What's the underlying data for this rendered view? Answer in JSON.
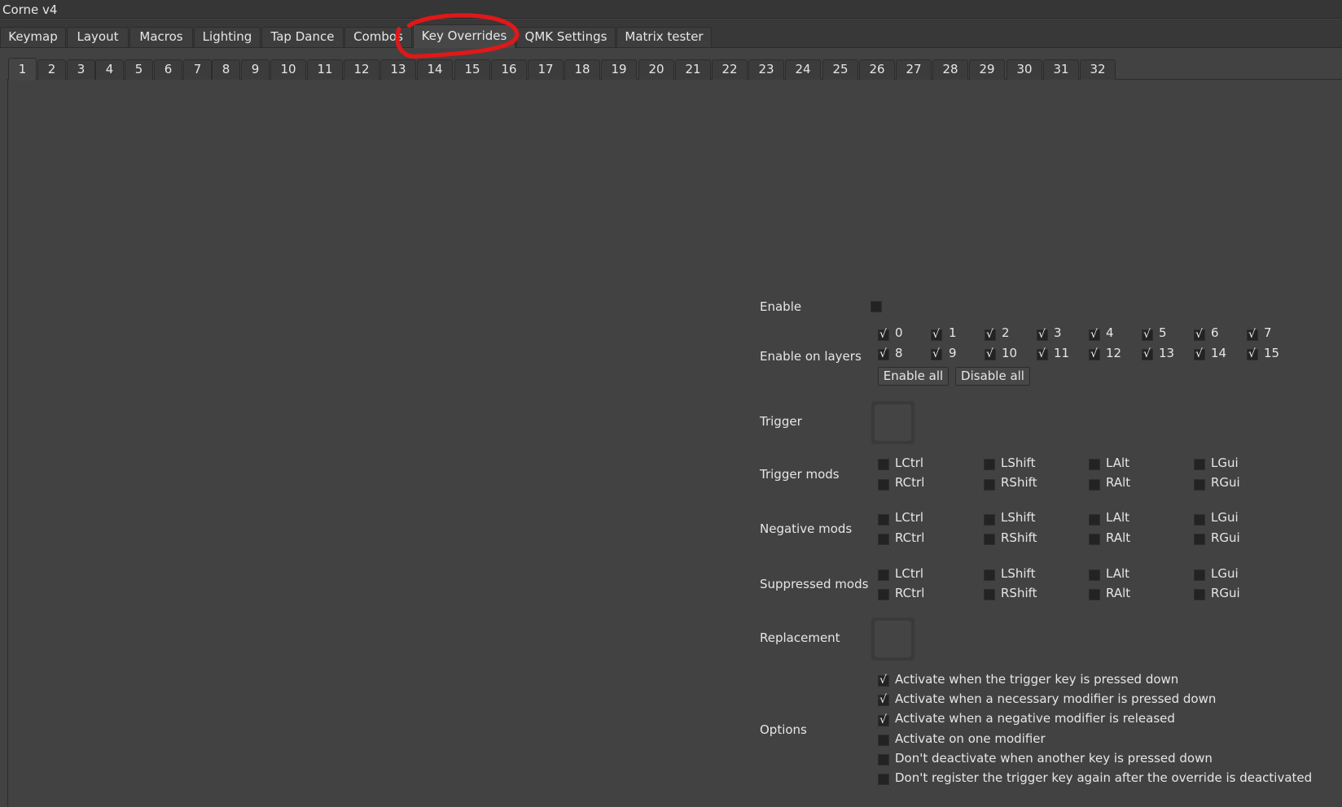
{
  "window": {
    "title": "Corne v4"
  },
  "tabs": [
    {
      "label": "Keymap"
    },
    {
      "label": "Layout"
    },
    {
      "label": "Macros"
    },
    {
      "label": "Lighting"
    },
    {
      "label": "Tap Dance"
    },
    {
      "label": "Combos"
    },
    {
      "label": "Key Overrides",
      "active": true
    },
    {
      "label": "QMK Settings"
    },
    {
      "label": "Matrix tester"
    }
  ],
  "override_tabs": [
    "1",
    "2",
    "3",
    "4",
    "5",
    "6",
    "7",
    "8",
    "9",
    "10",
    "11",
    "12",
    "13",
    "14",
    "15",
    "16",
    "17",
    "18",
    "19",
    "20",
    "21",
    "22",
    "23",
    "24",
    "25",
    "26",
    "27",
    "28",
    "29",
    "30",
    "31",
    "32"
  ],
  "active_override": "1",
  "form": {
    "enable_label": "Enable",
    "enable_checked": false,
    "layers_label": "Enable on layers",
    "layers": [
      {
        "n": "0",
        "c": true
      },
      {
        "n": "1",
        "c": true
      },
      {
        "n": "2",
        "c": true
      },
      {
        "n": "3",
        "c": true
      },
      {
        "n": "4",
        "c": true
      },
      {
        "n": "5",
        "c": true
      },
      {
        "n": "6",
        "c": true
      },
      {
        "n": "7",
        "c": true
      },
      {
        "n": "8",
        "c": true
      },
      {
        "n": "9",
        "c": true
      },
      {
        "n": "10",
        "c": true
      },
      {
        "n": "11",
        "c": true
      },
      {
        "n": "12",
        "c": true
      },
      {
        "n": "13",
        "c": true
      },
      {
        "n": "14",
        "c": true
      },
      {
        "n": "15",
        "c": true
      }
    ],
    "enable_all": "Enable all",
    "disable_all": "Disable all",
    "trigger_label": "Trigger",
    "trigger_mods_label": "Trigger mods",
    "negative_mods_label": "Negative mods",
    "suppressed_mods_label": "Suppressed mods",
    "mods": [
      "LCtrl",
      "LShift",
      "LAlt",
      "LGui",
      "RCtrl",
      "RShift",
      "RAlt",
      "RGui"
    ],
    "replacement_label": "Replacement",
    "options_label": "Options",
    "options": [
      {
        "label": "Activate when the trigger key is pressed down",
        "c": true
      },
      {
        "label": "Activate when a necessary modifier is pressed down",
        "c": true
      },
      {
        "label": "Activate when a negative modifier is released",
        "c": true
      },
      {
        "label": "Activate on one modifier",
        "c": false
      },
      {
        "label": "Don't deactivate when another key is pressed down",
        "c": false
      },
      {
        "label": "Don't register the trigger key again after the override is deactivated",
        "c": false
      }
    ]
  },
  "annotation_color": "#e01818"
}
